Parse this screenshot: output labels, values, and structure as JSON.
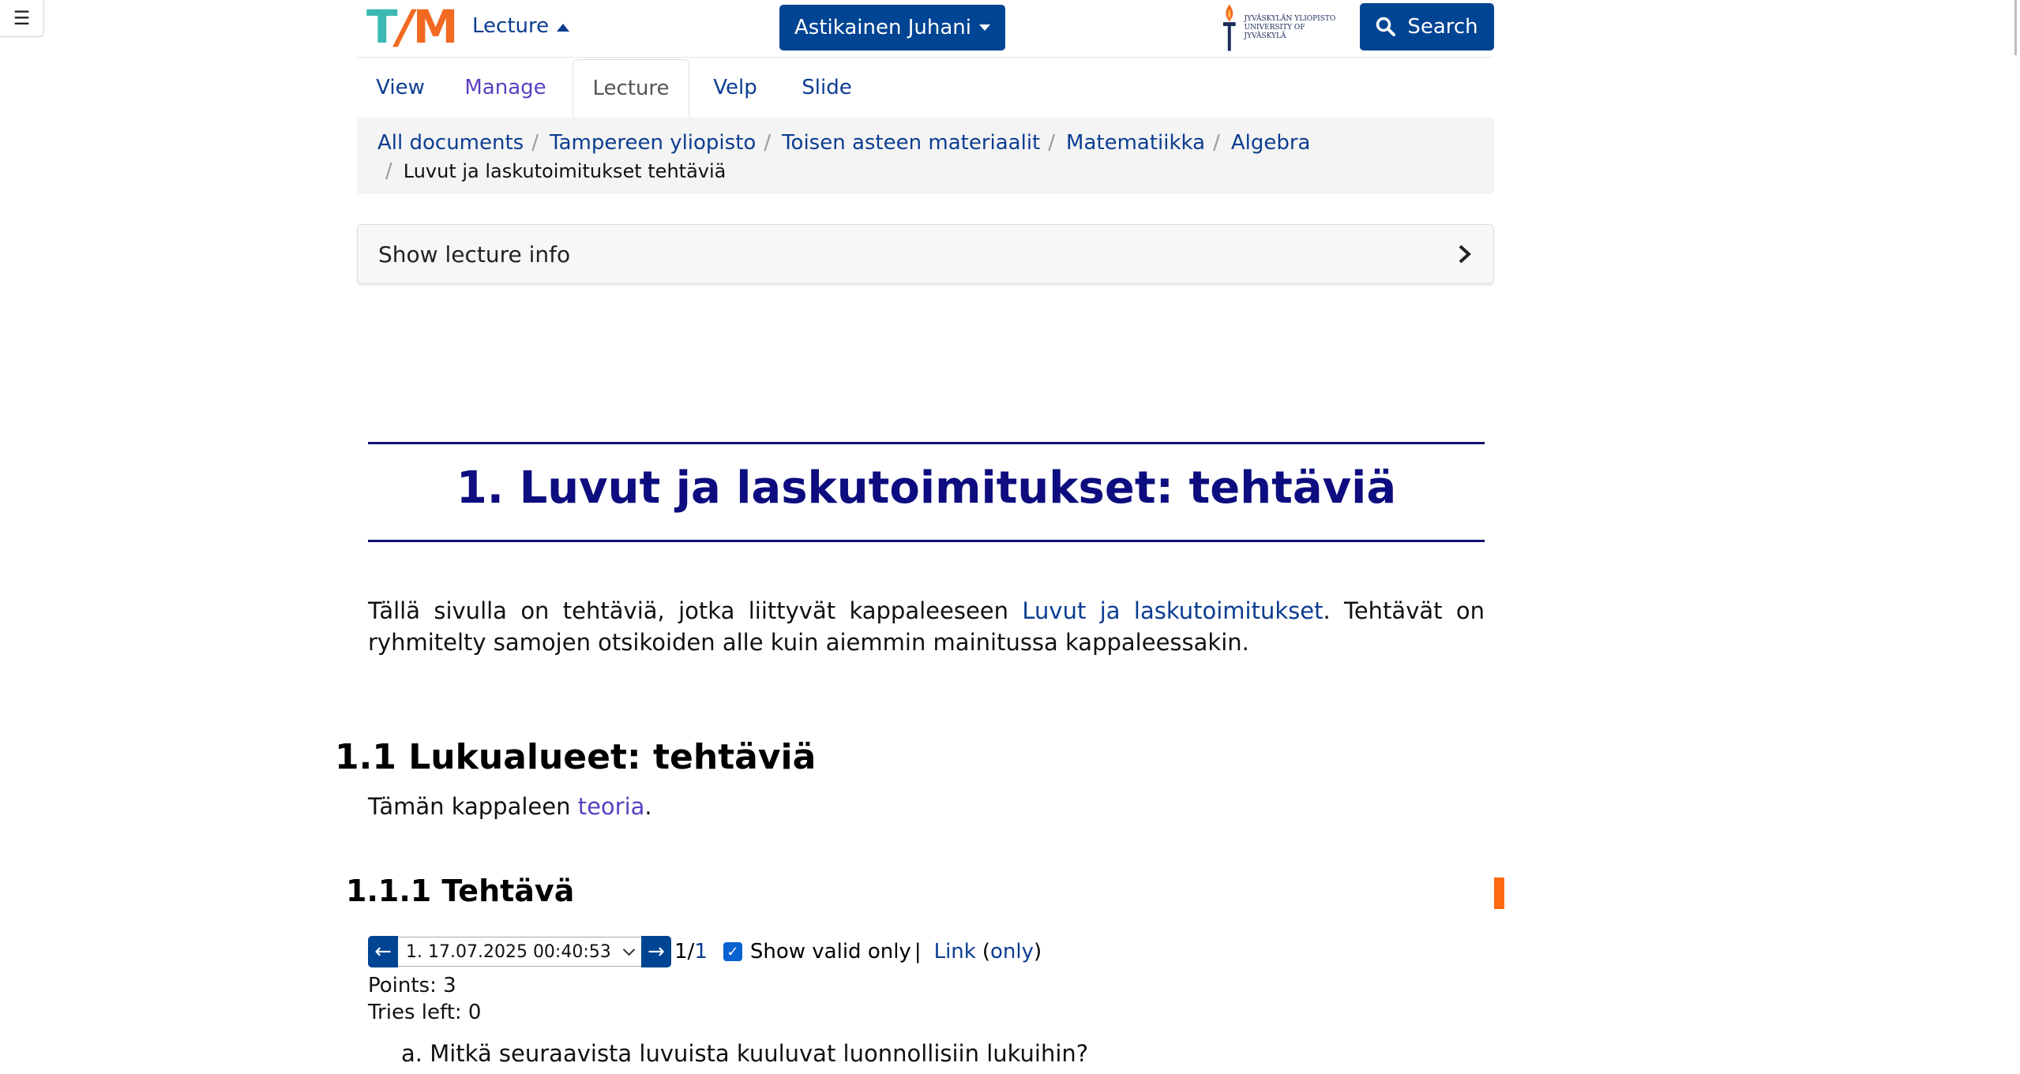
{
  "menu_icon": "hamburger-icon",
  "header": {
    "logo_t": "T",
    "logo_slash": "/",
    "logo_m": "M",
    "lecture_label": "Lecture",
    "user_name": "Astikainen Juhani",
    "university_fi": "JYVÄSKYLÄN YLIOPISTO",
    "university_en": "UNIVERSITY OF JYVÄSKYLÄ",
    "search_label": "Search"
  },
  "tabs": [
    {
      "label": "View"
    },
    {
      "label": "Manage"
    },
    {
      "label": "Lecture"
    },
    {
      "label": "Velp"
    },
    {
      "label": "Slide"
    }
  ],
  "breadcrumb": {
    "items": [
      "All documents",
      "Tampereen yliopisto",
      "Toisen asteen materiaalit",
      "Matematiikka",
      "Algebra"
    ],
    "current": "Luvut ja laskutoimitukset tehtäviä"
  },
  "lecture_info": {
    "label": "Show lecture info"
  },
  "document": {
    "title": "1. Luvut ja laskutoimitukset: tehtäviä",
    "intro_before": "Tällä sivulla on tehtäviä, jotka liittyvät kappaleeseen ",
    "intro_link": "Luvut ja laskutoimitukset",
    "intro_after": ". Tehtävät on ryhmitelty samojen otsikoiden alle kuin aiemmin mainitussa kappaleessakin.",
    "section_title": "1.1 Lukualueet: tehtäviä",
    "section_text_before": "Tämän kappaleen ",
    "section_link": "teoria",
    "section_text_after": ".",
    "task_title": "1.1.1 Tehtävä"
  },
  "answer_browser": {
    "prev": "←",
    "next": "→",
    "selected_answer": "1. 17.07.2025 00:40:53",
    "count_current": "1/",
    "count_total": "1",
    "show_valid_only": "Show valid only",
    "show_valid_checked": true,
    "pipe": "|",
    "link_label": "Link",
    "only_label": "only",
    "points": "Points: 3",
    "tries_left": "Tries left: 0"
  },
  "question_a": "a. Mitkä seuraavista luvuista kuuluvat luonnollisiin lukuihin?"
}
